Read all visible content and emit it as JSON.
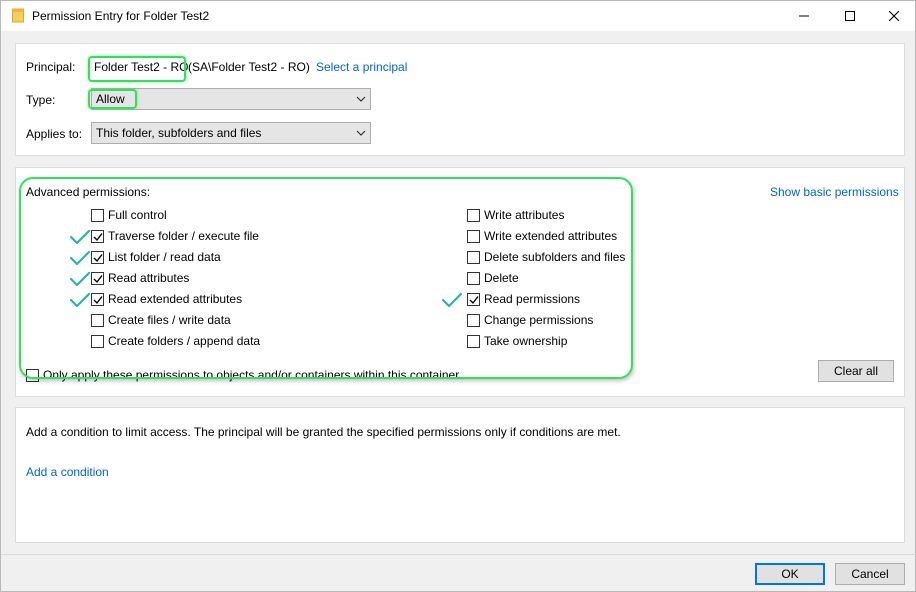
{
  "window": {
    "title": "Permission Entry for Folder Test2"
  },
  "principal": {
    "label": "Principal:",
    "name": "Folder Test2 - RO",
    "path": "(SA\\Folder Test2 - RO)",
    "select_link": "Select a principal"
  },
  "type": {
    "label": "Type:",
    "value": "Allow"
  },
  "applies_to": {
    "label": "Applies to:",
    "value": "This folder, subfolders and files"
  },
  "advanced": {
    "heading": "Advanced permissions:",
    "show_basic_link": "Show basic permissions",
    "left": [
      {
        "label": "Full control",
        "checked": false
      },
      {
        "label": "Traverse folder / execute file",
        "checked": true
      },
      {
        "label": "List folder / read data",
        "checked": true
      },
      {
        "label": "Read attributes",
        "checked": true
      },
      {
        "label": "Read extended attributes",
        "checked": true
      },
      {
        "label": "Create files / write data",
        "checked": false
      },
      {
        "label": "Create folders / append data",
        "checked": false
      }
    ],
    "right": [
      {
        "label": "Write attributes",
        "checked": false
      },
      {
        "label": "Write extended attributes",
        "checked": false
      },
      {
        "label": "Delete subfolders and files",
        "checked": false
      },
      {
        "label": "Delete",
        "checked": false
      },
      {
        "label": "Read permissions",
        "checked": true
      },
      {
        "label": "Change permissions",
        "checked": false
      },
      {
        "label": "Take ownership",
        "checked": false
      }
    ],
    "only_apply_label": "Only apply these permissions to objects and/or containers within this container",
    "only_apply_checked": false,
    "clear_all_label": "Clear all"
  },
  "condition": {
    "description": "Add a condition to limit access. The principal will be granted the specified permissions only if conditions are met.",
    "add_link": "Add a condition"
  },
  "footer": {
    "ok_label": "OK",
    "cancel_label": "Cancel"
  },
  "colors": {
    "highlight": "#33e05a",
    "annotation_tick": "#2bb5a0",
    "link": "#0066cc",
    "default_button_border": "#0078d7"
  }
}
